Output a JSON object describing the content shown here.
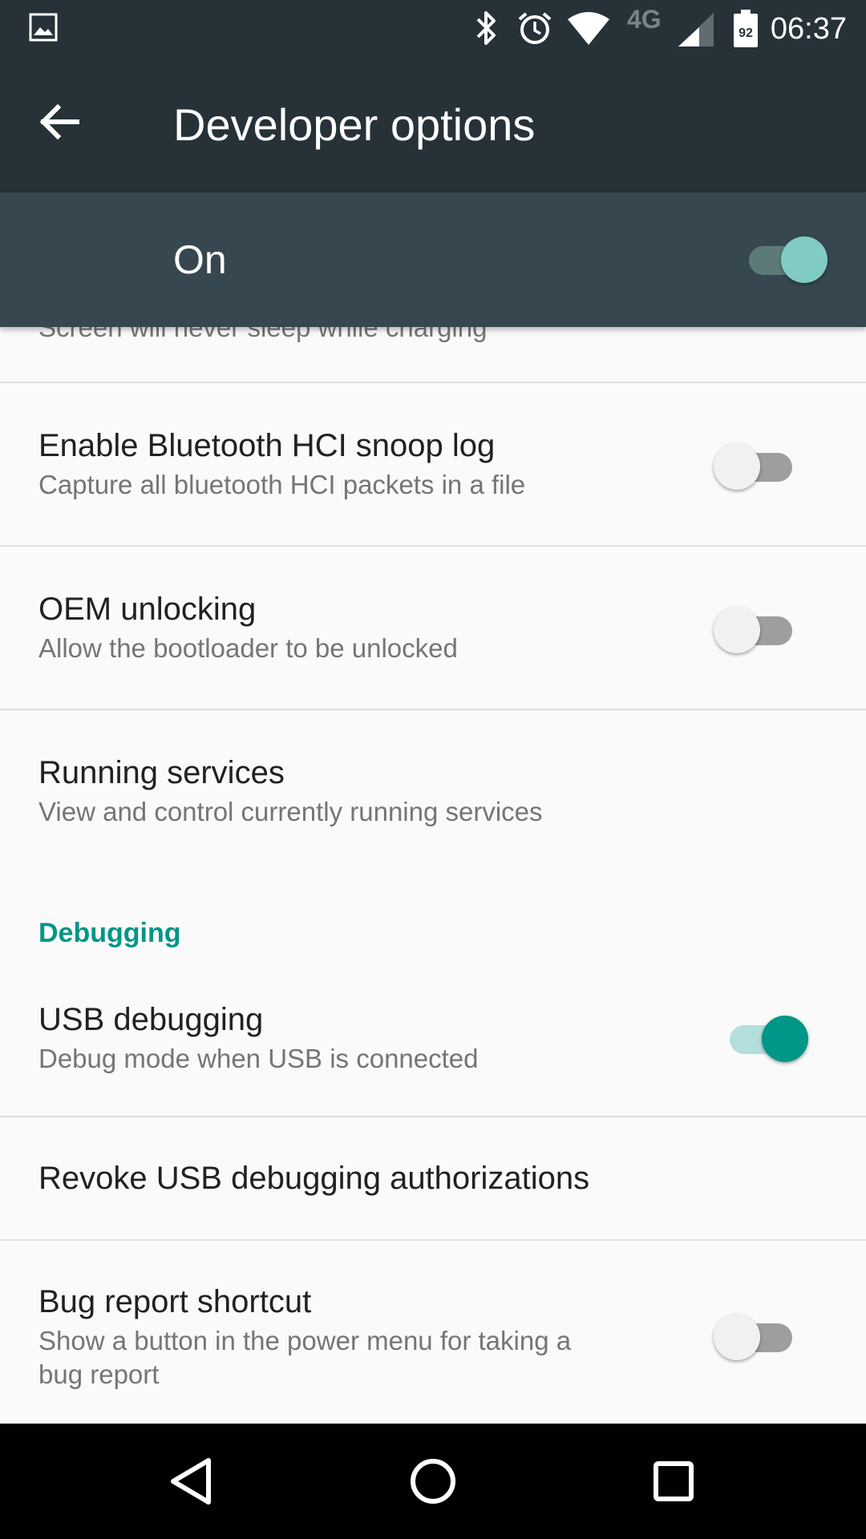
{
  "status_bar": {
    "time": "06:37",
    "network": "4G",
    "battery": "92",
    "icons": [
      "gallery-icon",
      "bluetooth-icon",
      "alarm-icon",
      "wifi-icon",
      "signal-icon",
      "battery-icon"
    ]
  },
  "app_bar": {
    "title": "Developer options",
    "back_icon": "arrow-back-icon"
  },
  "master_switch": {
    "label": "On",
    "checked": true
  },
  "settings": {
    "partial_summary": "Screen will never sleep while charging",
    "items": [
      {
        "title": "Enable Bluetooth HCI snoop log",
        "summary": "Capture all bluetooth HCI packets in a file",
        "toggle": false
      },
      {
        "title": "OEM unlocking",
        "summary": "Allow the bootloader to be unlocked",
        "toggle": false
      },
      {
        "title": "Running services",
        "summary": "View and control currently running services"
      },
      {
        "title": "USB debugging",
        "summary": "Debug mode when USB is connected",
        "toggle": true
      },
      {
        "title": "Revoke USB debugging authorizations"
      },
      {
        "title": "Bug report shortcut",
        "summary_line1": "Show a button in the power menu for taking a",
        "summary_line2": "bug report",
        "toggle": false
      }
    ],
    "category_debugging": "Debugging"
  },
  "nav_bar": {
    "icons": [
      "back-triangle-icon",
      "home-circle-icon",
      "recents-square-icon"
    ]
  },
  "colors": {
    "accent": "#009688",
    "toolbar": "#263238",
    "master_bar": "#37474f"
  }
}
